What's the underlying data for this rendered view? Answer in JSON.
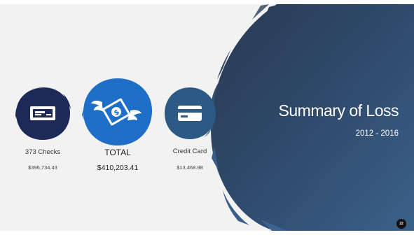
{
  "slide": {
    "title": "Summary of Loss",
    "years": "2012  -  2016",
    "page_number": "22"
  },
  "items": [
    {
      "name": "373 Checks",
      "value": "$396,734.43",
      "icon": "check-icon",
      "color": "#1d2a57"
    },
    {
      "name": "TOTAL",
      "value": "$410,203.41",
      "icon": "flying-money-icon",
      "color": "#1f6fc9"
    },
    {
      "name": "Credit Card",
      "value": "$13,468.98",
      "icon": "credit-card-icon",
      "color": "#2d5a85"
    }
  ],
  "colors": {
    "background": "#f2f2f2",
    "brush_dark": "#2b3f5a",
    "brush_light": "#3a5d84"
  }
}
